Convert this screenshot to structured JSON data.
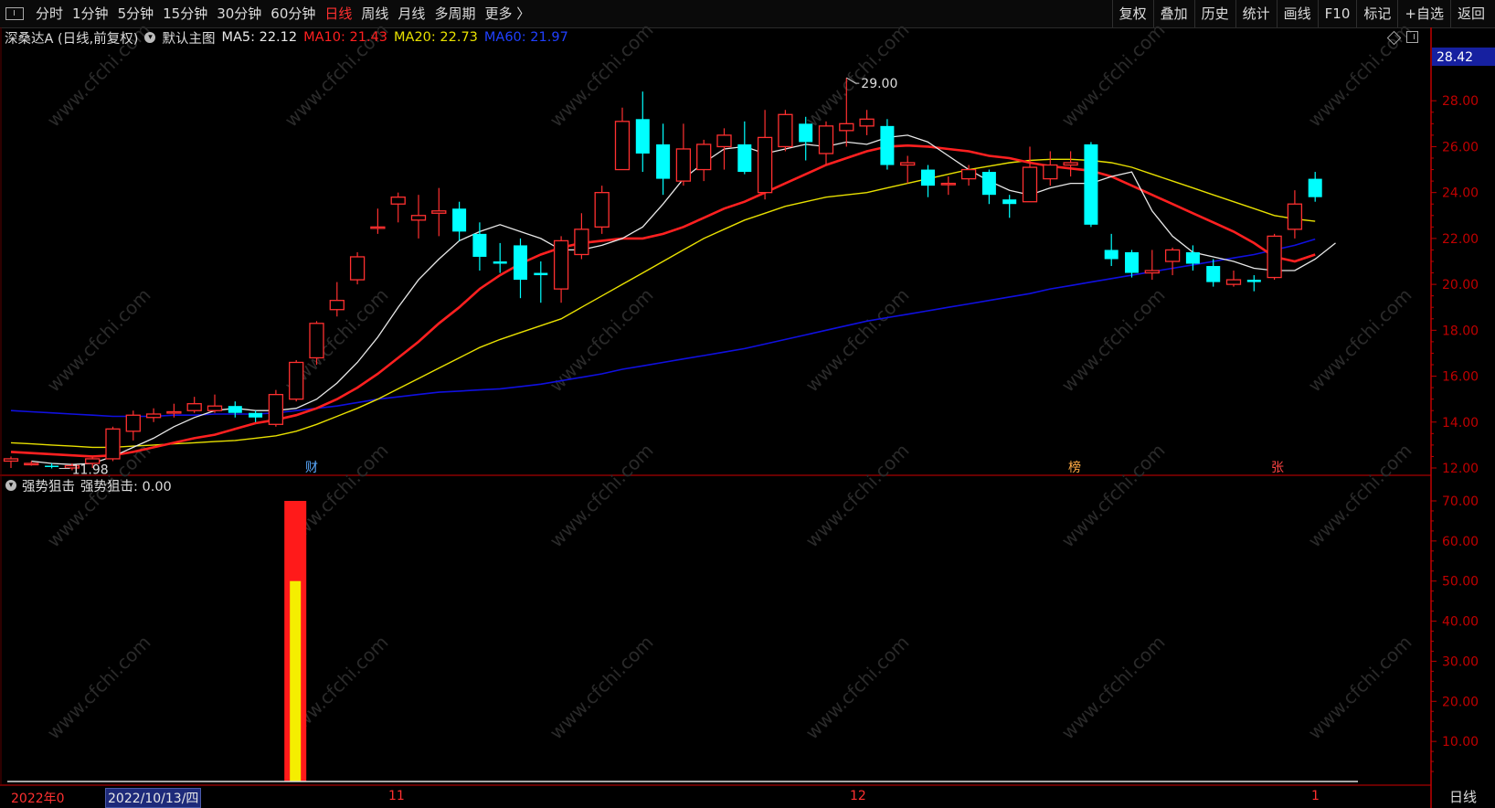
{
  "toolbar": {
    "periods": [
      "分时",
      "1分钟",
      "5分钟",
      "15分钟",
      "30分钟",
      "60分钟",
      "日线",
      "周线",
      "月线",
      "多周期",
      "更多 〉"
    ],
    "active_period": "日线",
    "right_buttons": [
      "复权",
      "叠加",
      "历史",
      "统计",
      "画线",
      "F10",
      "标记",
      "+自选",
      "返回"
    ]
  },
  "info": {
    "stock": "深桑达A (日线,前复权)",
    "template": "默认主图",
    "ma5": "MA5: 22.12",
    "ma10": "MA10: 21.43",
    "ma20": "MA20: 22.73",
    "ma60": "MA60: 21.97"
  },
  "colors": {
    "up": "#ff3030",
    "down": "#00ffff",
    "ma5": "#e8e8e8",
    "ma10": "#ff2020",
    "ma20": "#e8e000",
    "ma60": "#1010e0",
    "axis": "#c00000",
    "panel_border": "#8a0000"
  },
  "price_axis": {
    "current_price_label": "28.42",
    "ticks": [
      "28.00",
      "26.00",
      "24.00",
      "22.00",
      "20.00",
      "18.00",
      "16.00",
      "14.00",
      "12.00"
    ]
  },
  "annotations": {
    "high": "29.00",
    "low": "11.98"
  },
  "event_markers": [
    {
      "text": "财",
      "color": "#5aaaff"
    },
    {
      "text": "榜",
      "color": "#ffaa44"
    },
    {
      "text": "张",
      "color": "#ff4444"
    }
  ],
  "sub_panel": {
    "indicator": "强势狙击",
    "value_label": "强势狙击: 0.00",
    "ticks": [
      "70.00",
      "60.00",
      "50.00",
      "40.00",
      "30.00",
      "20.00",
      "10.00"
    ]
  },
  "date_axis": {
    "year_label": "2022年0",
    "selected_date": "2022/10/13/四",
    "month_labels": [
      "11",
      "12",
      "1"
    ]
  },
  "period_label": "日线",
  "watermark": "www.cfchi.com",
  "chart_data": {
    "type": "candlestick",
    "ylim": [
      11.2,
      29.8
    ],
    "candles": [
      [
        12.3,
        12.4,
        12.5,
        12.0
      ],
      [
        12.2,
        12.2,
        12.3,
        12.1
      ],
      [
        12.1,
        12.05,
        12.2,
        11.98
      ],
      [
        12.0,
        12.1,
        12.2,
        11.9
      ],
      [
        12.2,
        12.4,
        12.5,
        12.0
      ],
      [
        12.4,
        13.7,
        13.8,
        12.3
      ],
      [
        13.6,
        14.3,
        14.5,
        13.2
      ],
      [
        14.2,
        14.35,
        14.6,
        14.0
      ],
      [
        14.4,
        14.45,
        14.8,
        14.2
      ],
      [
        14.5,
        14.8,
        15.1,
        14.4
      ],
      [
        14.5,
        14.7,
        15.2,
        14.4
      ],
      [
        14.7,
        14.4,
        14.9,
        14.2
      ],
      [
        14.4,
        14.2,
        14.5,
        14.0
      ],
      [
        13.9,
        15.2,
        15.4,
        13.8
      ],
      [
        15.0,
        16.6,
        16.7,
        14.9
      ],
      [
        16.8,
        18.3,
        18.4,
        16.5
      ],
      [
        18.9,
        19.3,
        20.1,
        18.6
      ],
      [
        20.2,
        21.2,
        21.4,
        20.0
      ],
      [
        22.5,
        22.5,
        23.3,
        22.2
      ],
      [
        23.5,
        23.8,
        24.0,
        22.7
      ],
      [
        22.8,
        23.0,
        23.9,
        22.0
      ],
      [
        23.1,
        23.2,
        24.2,
        22.1
      ],
      [
        23.3,
        22.3,
        23.6,
        21.9
      ],
      [
        22.2,
        21.2,
        22.7,
        20.6
      ],
      [
        21.0,
        20.9,
        21.8,
        20.5
      ],
      [
        21.7,
        20.2,
        22.0,
        19.4
      ],
      [
        20.5,
        20.4,
        21.0,
        19.2
      ],
      [
        19.8,
        21.9,
        22.1,
        19.2
      ],
      [
        21.3,
        22.4,
        23.1,
        21.1
      ],
      [
        22.5,
        24.0,
        24.3,
        22.2
      ],
      [
        25.0,
        27.1,
        27.7,
        25.0
      ],
      [
        27.2,
        25.7,
        28.4,
        24.9
      ],
      [
        26.1,
        24.6,
        27.0,
        23.9
      ],
      [
        24.5,
        25.9,
        27.0,
        24.3
      ],
      [
        25.0,
        26.1,
        26.3,
        24.5
      ],
      [
        26.0,
        26.5,
        26.8,
        25.0
      ],
      [
        26.1,
        24.9,
        27.1,
        24.8
      ],
      [
        24.0,
        26.4,
        27.6,
        23.7
      ],
      [
        26.0,
        27.4,
        27.6,
        25.8
      ],
      [
        27.0,
        26.2,
        27.3,
        25.4
      ],
      [
        25.7,
        26.9,
        27.1,
        25.2
      ],
      [
        26.7,
        27.0,
        29.0,
        26.0
      ],
      [
        26.9,
        27.2,
        27.6,
        26.5
      ],
      [
        26.9,
        25.2,
        27.2,
        25.0
      ],
      [
        25.2,
        25.3,
        25.6,
        24.4
      ],
      [
        25.0,
        24.3,
        25.2,
        23.8
      ],
      [
        24.4,
        24.4,
        24.7,
        23.9
      ],
      [
        24.6,
        25.0,
        25.2,
        24.3
      ],
      [
        24.9,
        23.9,
        25.0,
        23.5
      ],
      [
        23.7,
        23.5,
        23.9,
        22.9
      ],
      [
        23.6,
        25.1,
        26.0,
        23.6
      ],
      [
        24.6,
        25.2,
        25.8,
        24.3
      ],
      [
        25.2,
        25.3,
        25.8,
        24.7
      ],
      [
        26.1,
        22.6,
        26.2,
        22.5
      ],
      [
        21.5,
        21.1,
        22.2,
        20.8
      ],
      [
        21.4,
        20.5,
        21.5,
        20.3
      ],
      [
        20.5,
        20.6,
        21.5,
        20.2
      ],
      [
        21.0,
        21.5,
        21.6,
        20.4
      ],
      [
        21.4,
        20.9,
        21.7,
        20.6
      ],
      [
        20.8,
        20.1,
        21.1,
        19.9
      ],
      [
        20.0,
        20.2,
        20.6,
        19.9
      ],
      [
        20.2,
        20.1,
        20.4,
        19.7
      ],
      [
        20.3,
        22.1,
        22.2,
        20.2
      ],
      [
        22.4,
        23.5,
        24.1,
        22.0
      ],
      [
        24.6,
        23.8,
        24.9,
        23.6
      ]
    ],
    "ma_values": {
      "MA5": {
        "start": 1,
        "values": [
          12.3,
          12.2,
          12.15,
          12.2,
          12.5,
          12.9,
          13.3,
          13.8,
          14.2,
          14.5,
          14.6,
          14.5,
          14.5,
          14.6,
          15.0,
          15.7,
          16.6,
          17.7,
          19.0,
          20.2,
          21.1,
          21.9,
          22.3,
          22.6,
          22.3,
          22.0,
          21.5,
          21.5,
          21.7,
          22.0,
          22.5,
          23.5,
          24.6,
          25.3,
          25.9,
          26.0,
          25.7,
          25.9,
          26.1,
          26.0,
          26.2,
          26.1,
          26.4,
          26.5,
          26.2,
          25.6,
          25.0,
          24.5,
          24.1,
          23.9,
          24.2,
          24.4,
          24.4,
          24.7,
          24.9,
          23.2,
          22.1,
          21.4,
          21.2,
          21.0,
          20.7,
          20.6,
          20.6,
          21.1,
          21.8
        ]
      },
      "MA10": {
        "start": 0,
        "values": [
          12.7,
          12.65,
          12.6,
          12.55,
          12.5,
          12.55,
          12.7,
          12.9,
          13.1,
          13.3,
          13.45,
          13.7,
          13.95,
          14.1,
          14.3,
          14.6,
          15.0,
          15.5,
          16.1,
          16.8,
          17.5,
          18.3,
          19.0,
          19.8,
          20.4,
          20.9,
          21.3,
          21.6,
          21.8,
          21.9,
          22.0,
          22.0,
          22.2,
          22.5,
          22.9,
          23.3,
          23.6,
          24.0,
          24.4,
          24.8,
          25.2,
          25.5,
          25.8,
          26.0,
          26.05,
          26.0,
          25.9,
          25.8,
          25.6,
          25.5,
          25.3,
          25.15,
          25.05,
          24.95,
          24.7,
          24.3,
          23.9,
          23.5,
          23.1,
          22.7,
          22.3,
          21.8,
          21.2,
          21.0,
          21.3
        ]
      },
      "MA20": {
        "start": 0,
        "values": [
          13.1,
          13.05,
          13.0,
          12.95,
          12.9,
          12.9,
          12.95,
          13.0,
          13.05,
          13.1,
          13.15,
          13.2,
          13.3,
          13.4,
          13.6,
          13.9,
          14.25,
          14.6,
          15.0,
          15.45,
          15.9,
          16.35,
          16.8,
          17.25,
          17.6,
          17.9,
          18.2,
          18.5,
          19.0,
          19.5,
          20.0,
          20.5,
          21.0,
          21.5,
          22.0,
          22.4,
          22.8,
          23.1,
          23.4,
          23.6,
          23.8,
          23.9,
          24.0,
          24.2,
          24.4,
          24.6,
          24.8,
          25.0,
          25.15,
          25.3,
          25.4,
          25.45,
          25.45,
          25.4,
          25.3,
          25.1,
          24.8,
          24.5,
          24.2,
          23.9,
          23.6,
          23.3,
          23.0,
          22.85,
          22.75
        ]
      },
      "MA60": {
        "start": 0,
        "values": [
          14.5,
          14.45,
          14.4,
          14.35,
          14.3,
          14.25,
          14.25,
          14.25,
          14.3,
          14.3,
          14.35,
          14.35,
          14.35,
          14.4,
          14.5,
          14.6,
          14.7,
          14.85,
          15.0,
          15.1,
          15.2,
          15.3,
          15.35,
          15.4,
          15.45,
          15.55,
          15.65,
          15.8,
          15.95,
          16.1,
          16.3,
          16.45,
          16.6,
          16.75,
          16.9,
          17.05,
          17.2,
          17.4,
          17.6,
          17.8,
          18.0,
          18.2,
          18.4,
          18.55,
          18.7,
          18.85,
          19.0,
          19.15,
          19.3,
          19.45,
          19.6,
          19.8,
          19.95,
          20.1,
          20.25,
          20.4,
          20.55,
          20.7,
          20.85,
          21.0,
          21.15,
          21.3,
          21.5,
          21.7,
          21.97
        ]
      }
    },
    "indicator": {
      "name": "强势狙击",
      "ylim": [
        0,
        70
      ],
      "bar_index": 14,
      "outer_value": 70,
      "inner_value": 50
    }
  }
}
